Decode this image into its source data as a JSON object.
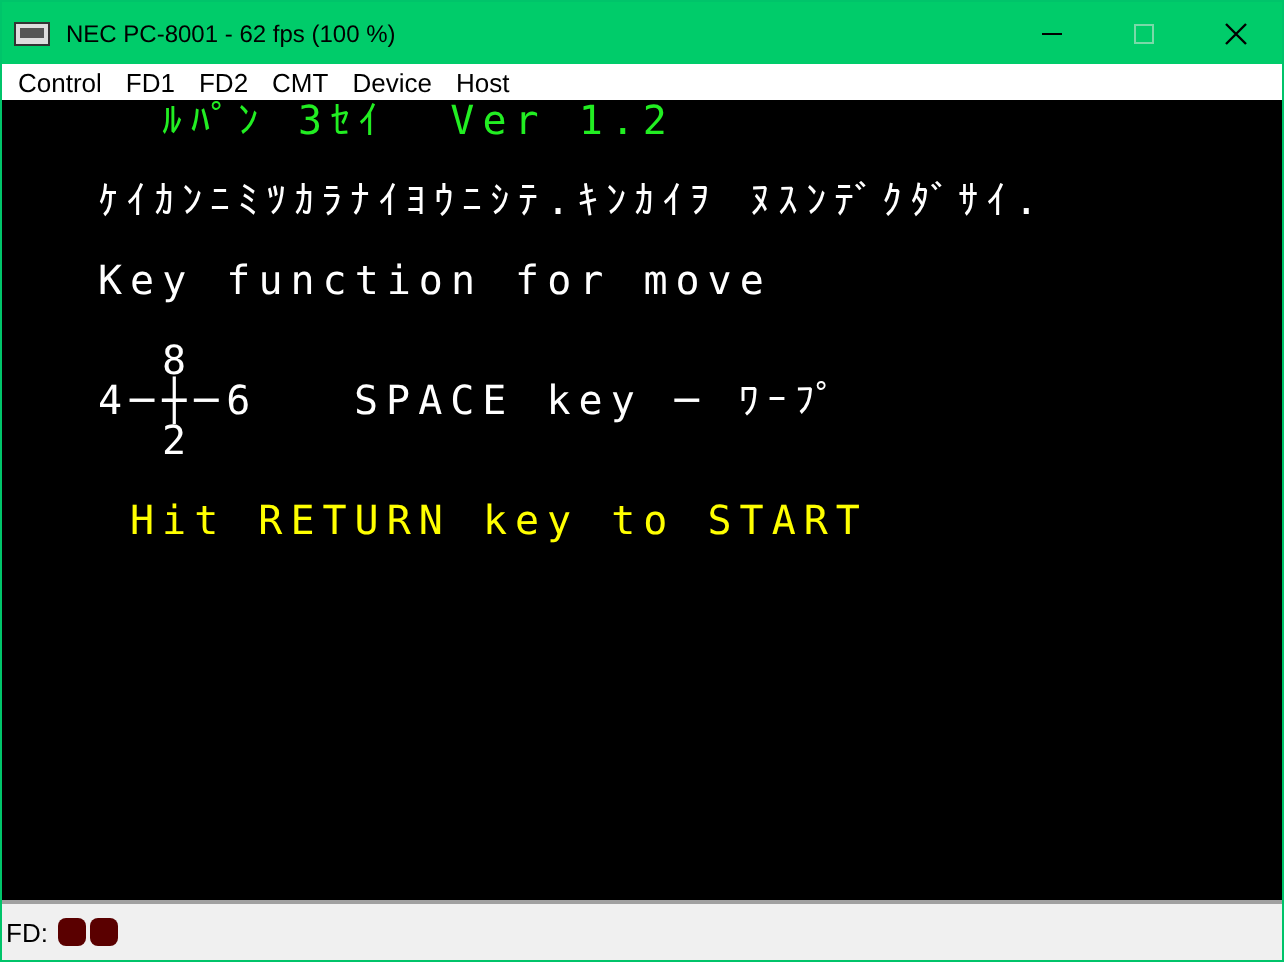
{
  "window": {
    "title": "NEC PC-8001 - 62 fps (100 %)",
    "maximize_disabled": true
  },
  "menu": [
    {
      "label": "Control"
    },
    {
      "label": "FD1"
    },
    {
      "label": "FD2"
    },
    {
      "label": "CMT"
    },
    {
      "label": "Device"
    },
    {
      "label": "Host"
    }
  ],
  "screen": {
    "title": "ﾙﾊﾟﾝ 3ｾｲ  Ver 1.2",
    "message": "ｹｲｶﾝﾆﾐﾂｶﾗﾅｲﾖｳﾆｼﾃ.ｷﾝｶｲｦ ﾇｽﾝﾃﾞｸﾀﾞｻｲ.",
    "heading": "Key function for move",
    "keypad": {
      "up": "8",
      "middle": "4─┼─6",
      "down": "2"
    },
    "warp": "SPACE key ─ ﾜｰﾌﾟ",
    "prompt": "Hit RETURN key to START"
  },
  "status_bar": {
    "label": "FD:",
    "drives": [
      {
        "on": false
      },
      {
        "on": false
      }
    ]
  }
}
